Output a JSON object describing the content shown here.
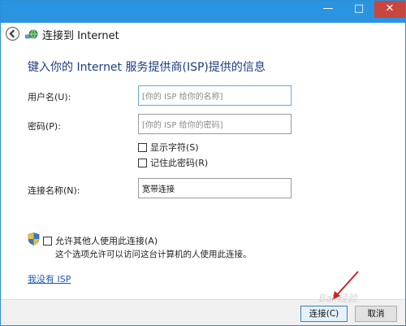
{
  "titlebar": {
    "minimize": "—",
    "maximize": "□",
    "close": "✕"
  },
  "nav": {
    "title": "连接到 Internet"
  },
  "page": {
    "heading": "键入你的 Internet 服务提供商(ISP)提供的信息"
  },
  "form": {
    "username_label": "用户名(U):",
    "username_placeholder": "[你的 ISP 给你的名称]",
    "password_label": "密码(P):",
    "password_placeholder": "[你的 ISP 给你的密码]",
    "show_chars_label": "显示字符(S)",
    "remember_pw_label": "记住此密码(R)",
    "conn_name_label": "连接名称(N):",
    "conn_name_value": "宽带连接"
  },
  "sharing": {
    "allow_label": "允许其他人使用此连接(A)",
    "note": "这个选项允许可以访问这台计算机的人使用此连接。"
  },
  "link": {
    "no_isp": "我没有 ISP"
  },
  "buttons": {
    "connect": "连接(C)",
    "cancel": "取消"
  },
  "watermark": "Bai 经验",
  "colors": {
    "titlebar": "#2b94e0",
    "close": "#c7463e",
    "heading": "#1c3d82",
    "link": "#1a58b5"
  }
}
